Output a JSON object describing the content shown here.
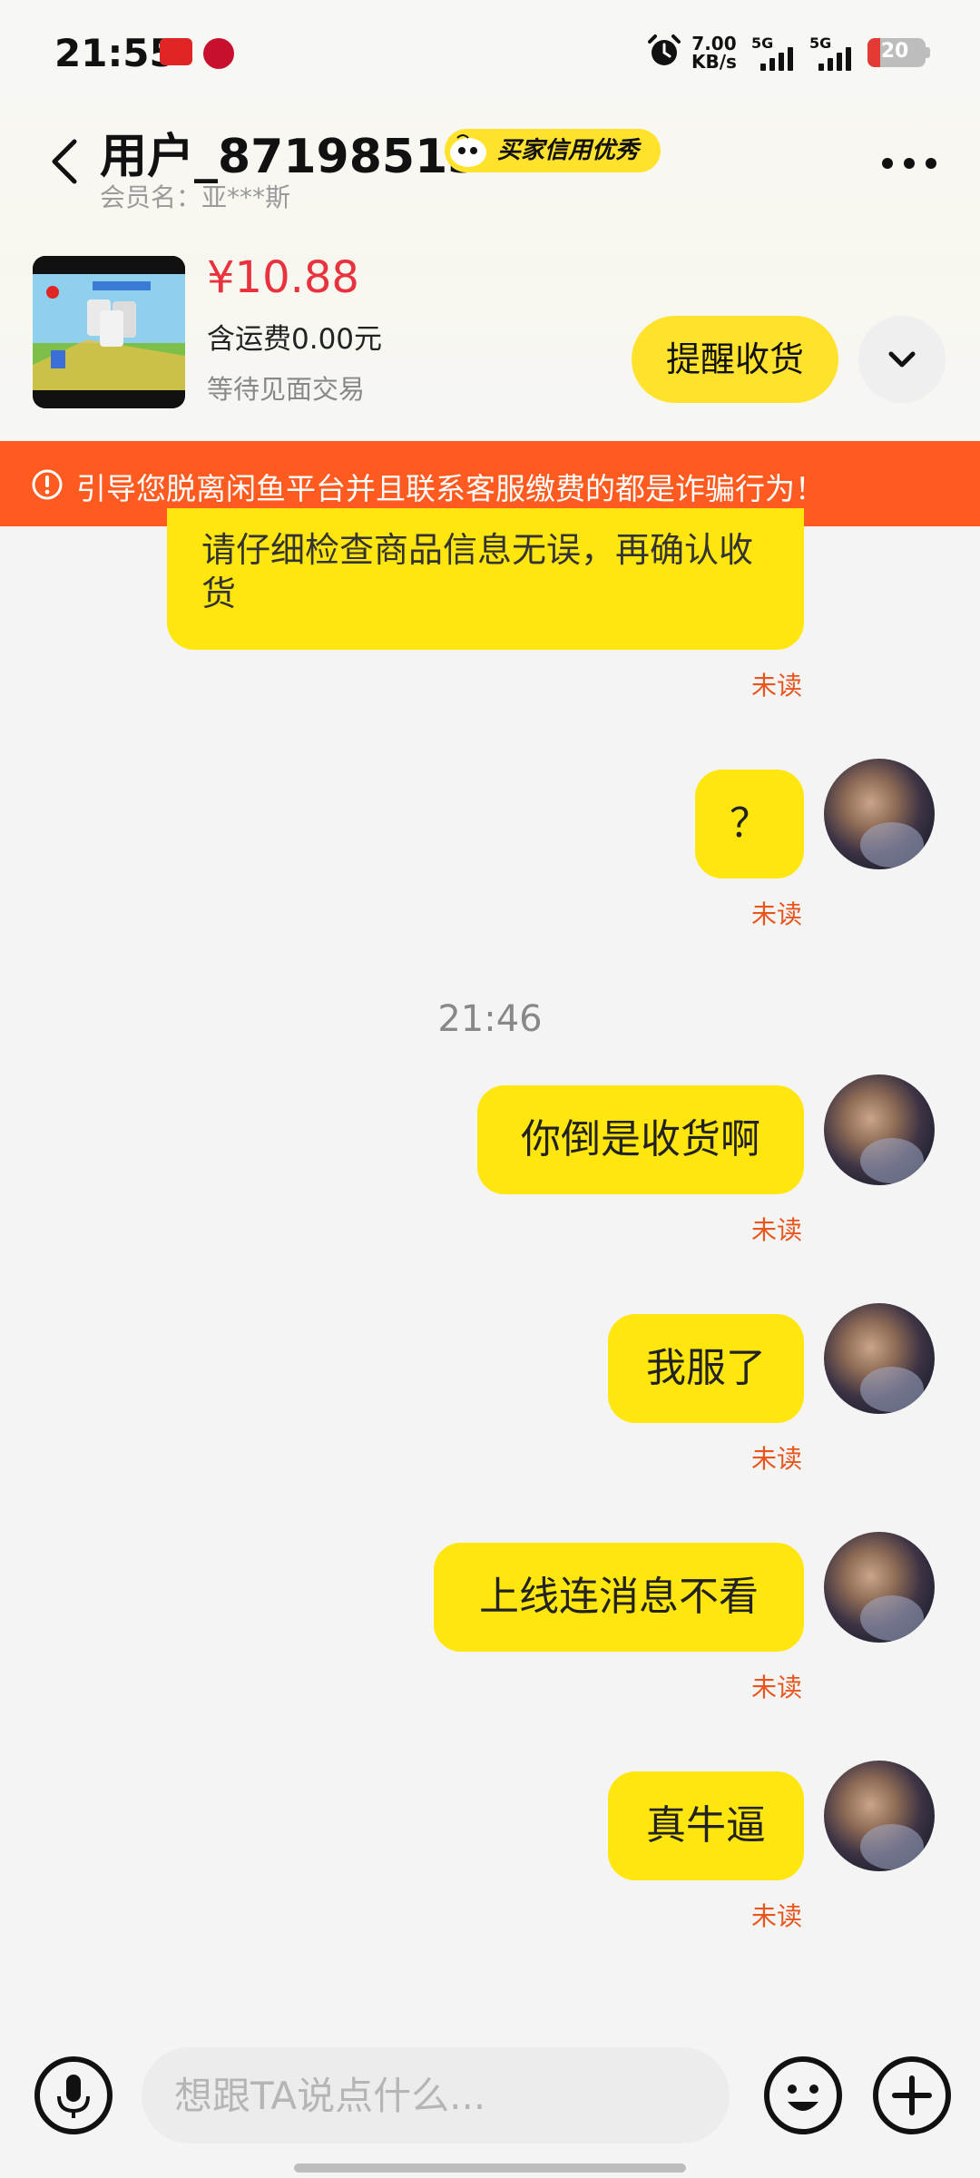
{
  "status_bar": {
    "time": "21:55",
    "net_speed_value": "7.00",
    "net_speed_unit": "KB/s",
    "signal_1_label": "5G",
    "signal_2_label": "5G",
    "battery": "20",
    "battery_color": "#e53935"
  },
  "header": {
    "title": "用户_87198513",
    "badge": "买家信用优秀",
    "subtitle": "会员名：亚***斯"
  },
  "product": {
    "price": "¥10.88",
    "shipping": "含运费0.00元",
    "status": "等待见面交易",
    "action": "提醒收货"
  },
  "warning": {
    "text": "引导您脱离闲鱼平台并且联系客服缴费的都是诈骗行为！",
    "color": "#ff5a1f"
  },
  "messages": {
    "partial": "请仔细检查商品信息无误，再确认收货",
    "timestamp": "21:46",
    "items": [
      {
        "text": "？",
        "status": "未读"
      },
      {
        "text": "你倒是收货啊",
        "status": "未读"
      },
      {
        "text": "我服了",
        "status": "未读"
      },
      {
        "text": "上线连消息不看",
        "status": "未读"
      },
      {
        "text": "真牛逼",
        "status": "未读"
      }
    ],
    "partial_status": "未读",
    "bubble_color": "#ffe60f",
    "unread_color": "#e8561e"
  },
  "input": {
    "placeholder": "想跟TA说点什么..."
  }
}
